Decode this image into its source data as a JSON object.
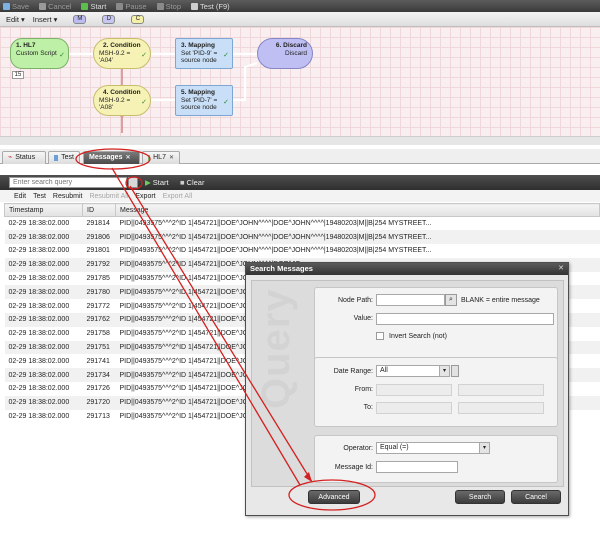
{
  "toolbar": {
    "items": [
      {
        "label": "Save",
        "color": "#7cb1e0",
        "icon": "save-icon",
        "enabled": false
      },
      {
        "label": "Cancel",
        "color": "#d9d9d9",
        "icon": "cancel-icon",
        "enabled": false
      },
      {
        "label": "Start",
        "color": "#5cbf4b",
        "icon": "play-icon",
        "enabled": true
      },
      {
        "label": "Pause",
        "color": "#d9d9d9",
        "icon": "pause-icon",
        "enabled": false
      },
      {
        "label": "Stop",
        "color": "#d9d9d9",
        "icon": "stop-icon",
        "enabled": false
      },
      {
        "label": "Test (F9)",
        "color": "#ffffff",
        "icon": "test-icon",
        "enabled": true
      }
    ]
  },
  "edit_toolbar": {
    "edit": "Edit",
    "insert": "Insert",
    "tags": [
      {
        "label": "M",
        "color": "#bcbcf2"
      },
      {
        "label": "D",
        "color": "#c6c6f3"
      },
      {
        "label": "C",
        "color": "#f4f0a8"
      }
    ]
  },
  "workflow": {
    "nodes": [
      {
        "title": "1. HL7",
        "line1": "Custom Script",
        "line2": ""
      },
      {
        "title": "2. Condition",
        "line1": "MSH-9.2 = 'A04'",
        "line2": ""
      },
      {
        "title": "3. Mapping",
        "line1": "Set 'PID-9' =",
        "line2": "source node"
      },
      {
        "title": "6. Discard",
        "line1": "Discard",
        "line2": ""
      },
      {
        "title": "4. Condition",
        "line1": "MSH-9.2 = 'A08'",
        "line2": ""
      },
      {
        "title": "5. Mapping",
        "line1": "Set 'PID-7' =",
        "line2": "source node"
      }
    ],
    "badge": "15"
  },
  "tabs": [
    {
      "label": "Status",
      "icon": "pulse-icon"
    },
    {
      "label": "Test",
      "icon": "test-icon"
    },
    {
      "label": "Messages",
      "active": true
    },
    {
      "label": "HL7",
      "icon": "hl7-icon"
    }
  ],
  "search": {
    "placeholder": "Enter search query",
    "start": "Start",
    "clear": "Clear"
  },
  "actions": {
    "edit": "Edit",
    "test": "Test",
    "resubmit": "Resubmit",
    "resubmit_all": "Resubmit All",
    "export": "Export",
    "export_all": "Export All"
  },
  "table": {
    "columns": [
      "Timestamp",
      "ID",
      "Message"
    ],
    "rows": [
      {
        "ts": "02-29 18:38:02.000",
        "id": "291814",
        "msg": "PID||0493575^^^2^ID 1|454721||DOE^JOHN^^^^|DOE^JOHN^^^^|19480203|M||B|254 MYSTREET..."
      },
      {
        "ts": "02-29 18:38:02.000",
        "id": "291806",
        "msg": "PID||0493575^^^2^ID 1|454721||DOE^JOHN^^^^|DOE^JOHN^^^^|19480203|M||B|254 MYSTREET..."
      },
      {
        "ts": "02-29 18:38:02.000",
        "id": "291801",
        "msg": "PID||0493575^^^2^ID 1|454721||DOE^JOHN^^^^|DOE^JOHN^^^^|19480203|M||B|254 MYSTREET..."
      },
      {
        "ts": "02-29 18:38:02.000",
        "id": "291792",
        "msg": "PID||0493575^^^2^ID 1|454721||DOE^JOHN^^^^|DOE^JO"
      },
      {
        "ts": "02-29 18:38:02.000",
        "id": "291785",
        "msg": "PID||0493575^^^2^ID 1|454721||DOE^JOHN^^^^|DOE^JO"
      },
      {
        "ts": "02-29 18:38:02.000",
        "id": "291780",
        "msg": "PID||0493575^^^2^ID 1|454721||DOE^JOHN^^^^|DOE^JO"
      },
      {
        "ts": "02-29 18:38:02.000",
        "id": "291772",
        "msg": "PID||0493575^^^2^ID 1|454721||DOE^JOHN^^^^|DOE^JO"
      },
      {
        "ts": "02-29 18:38:02.000",
        "id": "291762",
        "msg": "PID||0493575^^^2^ID 1|454721||DOE^JOHN^^^^|DOE^JO"
      },
      {
        "ts": "02-29 18:38:02.000",
        "id": "291758",
        "msg": "PID||0493575^^^2^ID 1|454721||DOE^JOHN^^^^|DOE^JO"
      },
      {
        "ts": "02-29 18:38:02.000",
        "id": "291751",
        "msg": "PID||0493575^^^2^ID 1|454721||DOE^JOHN^^^^|DOE^JO"
      },
      {
        "ts": "02-29 18:38:02.000",
        "id": "291741",
        "msg": "PID||0493575^^^2^ID 1|454721||DOE^JOHN^^^^|DOE^JO"
      },
      {
        "ts": "02-29 18:38:02.000",
        "id": "291734",
        "msg": "PID||0493575^^^2^ID 1|454721||DOE^JOHN^^^^|DOE^JO"
      },
      {
        "ts": "02-29 18:38:02.000",
        "id": "291726",
        "msg": "PID||0493575^^^2^ID 1|454721||DOE^JOHN^^^^|DOE^JO"
      },
      {
        "ts": "02-29 18:38:02.000",
        "id": "291720",
        "msg": "PID||0493575^^^2^ID 1|454721||DOE^JOHN^^^^|DOE^JO"
      },
      {
        "ts": "02-29 18:38:02.000",
        "id": "291713",
        "msg": "PID||0493575^^^2^ID 1|454721||DOE^JOHN^^^^|DOE^JO"
      }
    ]
  },
  "dialog": {
    "title": "Search Messages",
    "node_path_label": "Node Path:",
    "node_path_hint": "BLANK = entire message",
    "value_label": "Value:",
    "invert_label": "Invert Search (not)",
    "date_range_label": "Date Range:",
    "date_range_value": "All",
    "from_label": "From:",
    "to_label": "To:",
    "operator_label": "Operator:",
    "operator_value": "Equal (=)",
    "message_id_label": "Message Id:",
    "watermark": "Query",
    "advanced": "Advanced",
    "search": "Search",
    "cancel": "Cancel"
  },
  "annotations": {
    "color": "#d42020"
  }
}
